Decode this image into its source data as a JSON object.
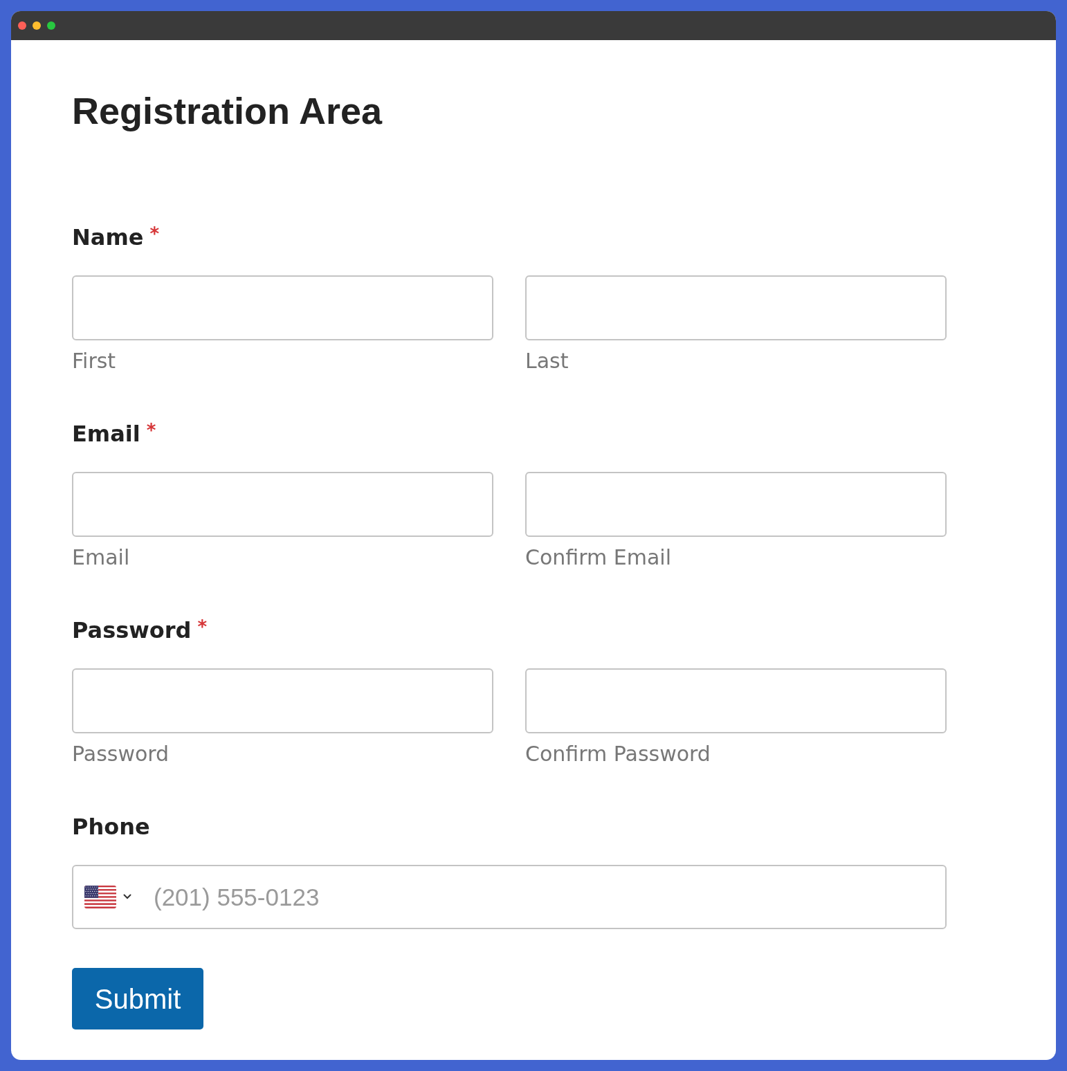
{
  "title": "Registration Area",
  "fields": [
    {
      "kind": "pair",
      "label": "Name",
      "required_mark": "*",
      "inputs": [
        {
          "caption": "First"
        },
        {
          "caption": "Last"
        }
      ]
    },
    {
      "kind": "pair",
      "label": "Email",
      "required_mark": "*",
      "inputs": [
        {
          "caption": "Email"
        },
        {
          "caption": "Confirm Email"
        }
      ]
    },
    {
      "kind": "pair",
      "label": "Password",
      "required_mark": "*",
      "inputs": [
        {
          "caption": "Password"
        },
        {
          "caption": "Confirm Password"
        }
      ]
    },
    {
      "kind": "phone",
      "label": "Phone",
      "placeholder": "(201) 555-0123"
    }
  ],
  "submit": "Submit"
}
